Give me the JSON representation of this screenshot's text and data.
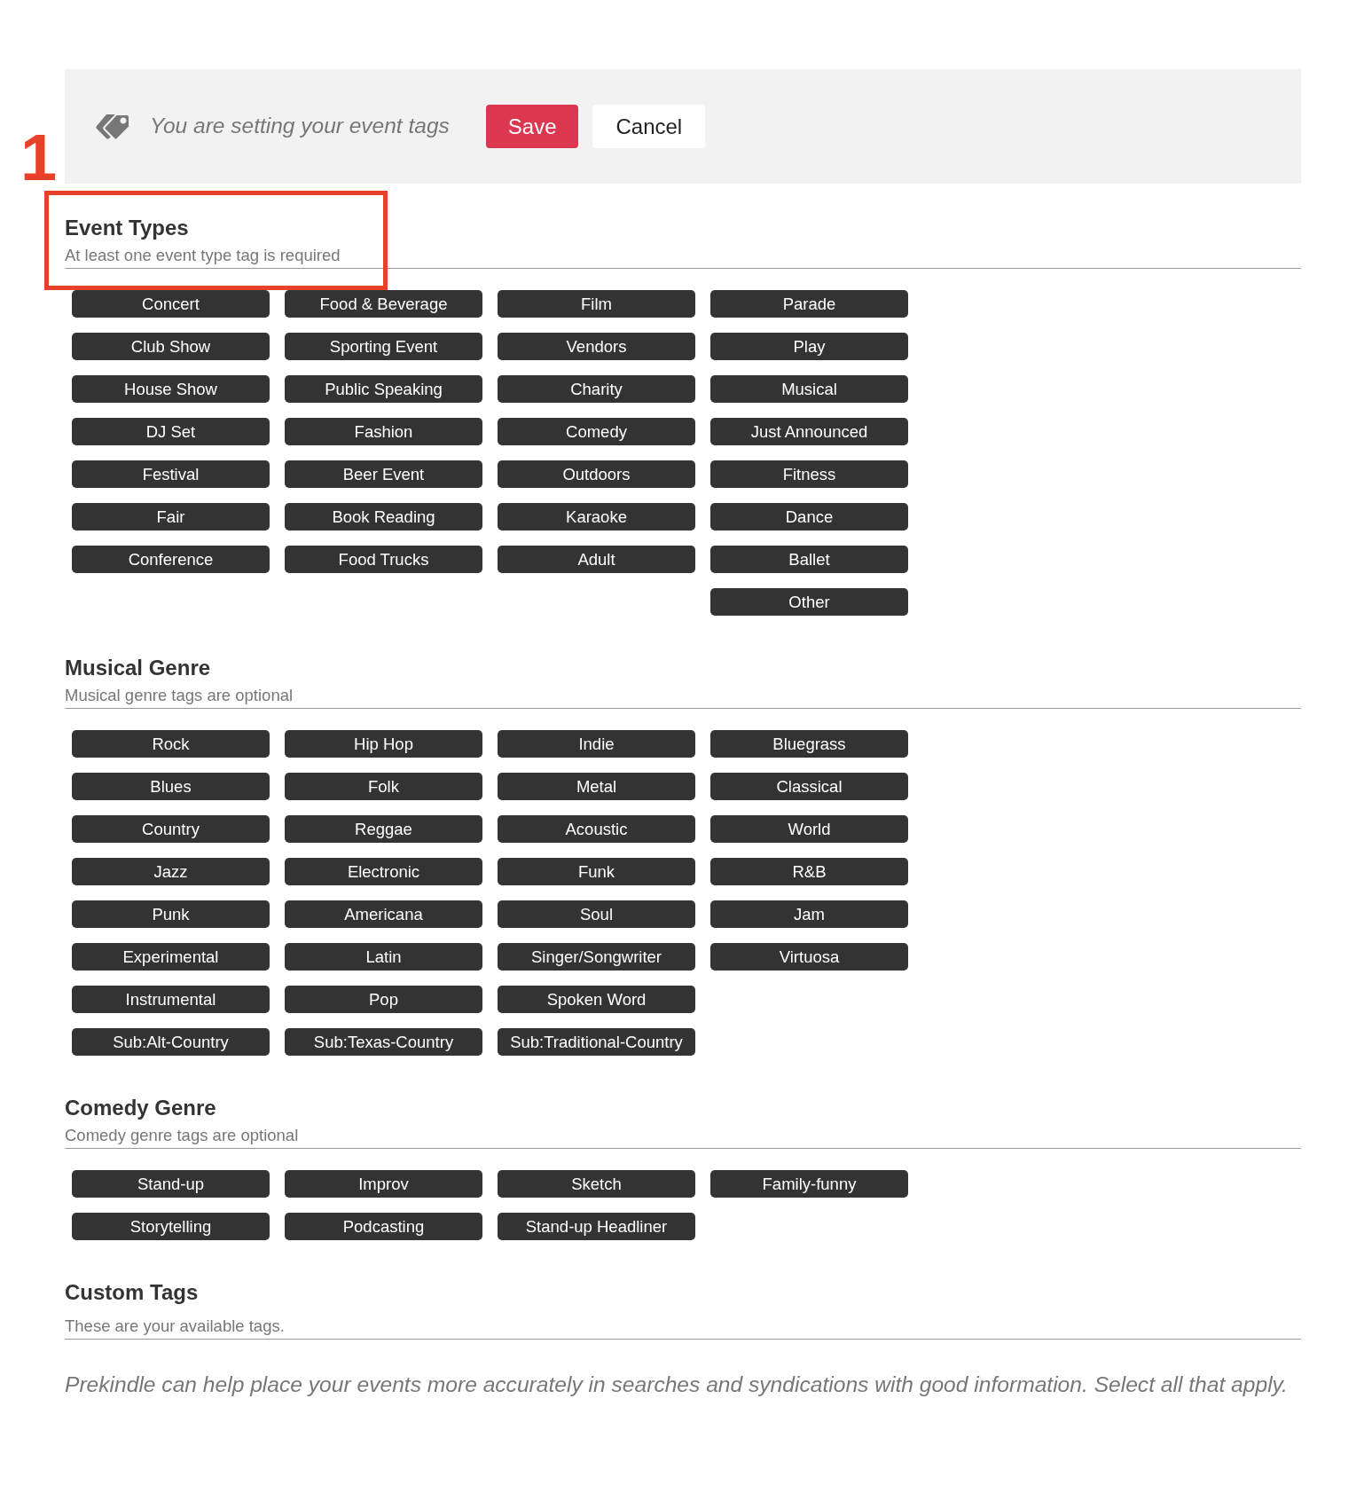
{
  "toolbar": {
    "message": "You are setting your event tags",
    "buttons": [
      {
        "label": "Save",
        "kind": "primary"
      },
      {
        "label": "Cancel",
        "kind": "secondary"
      }
    ]
  },
  "sections": [
    {
      "kind": "preset",
      "title": "Event Types",
      "subtitle": "At least one event type tag is required",
      "callout": "1",
      "columns": [
        [
          {
            "label": "Concert",
            "selected": false
          },
          {
            "label": "Club Show",
            "selected": false
          },
          {
            "label": "House Show",
            "selected": false
          },
          {
            "label": "DJ Set",
            "selected": false
          },
          {
            "label": "Festival",
            "selected": false
          },
          {
            "label": "Fair",
            "selected": false
          },
          {
            "label": "Conference",
            "selected": false
          }
        ],
        [
          {
            "label": "Food & Beverage",
            "selected": false
          },
          {
            "label": "Sporting Event",
            "selected": false
          },
          {
            "label": "Public Speaking",
            "selected": false
          },
          {
            "label": "Fashion",
            "selected": false
          },
          {
            "label": "Beer Event",
            "selected": false
          },
          {
            "label": "Book Reading",
            "selected": false
          },
          {
            "label": "Food Trucks",
            "selected": false
          }
        ],
        [
          {
            "label": "Film",
            "selected": false
          },
          {
            "label": "Vendors",
            "selected": false
          },
          {
            "label": "Charity",
            "selected": false
          },
          {
            "label": "Comedy",
            "selected": false
          },
          {
            "label": "Outdoors",
            "selected": false
          },
          {
            "label": "Karaoke",
            "selected": false
          },
          {
            "label": "Adult",
            "selected": false
          }
        ],
        [
          {
            "label": "Parade",
            "selected": false
          },
          {
            "label": "Play",
            "selected": false
          },
          {
            "label": "Musical",
            "selected": false
          },
          {
            "label": "Just Announced",
            "selected": false
          },
          {
            "label": "Fitness",
            "selected": false
          },
          {
            "label": "Dance",
            "selected": false
          },
          {
            "label": "Ballet",
            "selected": false
          },
          {
            "label": "Other",
            "selected": false
          }
        ]
      ]
    },
    {
      "kind": "preset",
      "title": "Musical Genre",
      "subtitle": "Musical genre tags are optional",
      "columns": [
        [
          {
            "label": "Rock",
            "selected": false
          },
          {
            "label": "Blues",
            "selected": false
          },
          {
            "label": "Country",
            "selected": false
          },
          {
            "label": "Jazz",
            "selected": false
          },
          {
            "label": "Punk",
            "selected": false
          },
          {
            "label": "Experimental",
            "selected": false
          },
          {
            "label": "Instrumental",
            "selected": false
          },
          {
            "label": "Sub:Alt-Country",
            "selected": false
          }
        ],
        [
          {
            "label": "Hip Hop",
            "selected": false
          },
          {
            "label": "Folk",
            "selected": false
          },
          {
            "label": "Reggae",
            "selected": false
          },
          {
            "label": "Electronic",
            "selected": false
          },
          {
            "label": "Americana",
            "selected": false
          },
          {
            "label": "Latin",
            "selected": false
          },
          {
            "label": "Pop",
            "selected": false
          },
          {
            "label": "Sub:Texas-Country",
            "selected": false
          }
        ],
        [
          {
            "label": "Indie",
            "selected": false
          },
          {
            "label": "Metal",
            "selected": false
          },
          {
            "label": "Acoustic",
            "selected": false
          },
          {
            "label": "Funk",
            "selected": false
          },
          {
            "label": "Soul",
            "selected": false
          },
          {
            "label": "Singer/Songwriter",
            "selected": false
          },
          {
            "label": "Spoken Word",
            "selected": false
          },
          {
            "label": "Sub:Traditional-Country",
            "selected": false
          }
        ],
        [
          {
            "label": "Bluegrass",
            "selected": false
          },
          {
            "label": "Classical",
            "selected": false
          },
          {
            "label": "World",
            "selected": false
          },
          {
            "label": "R&B",
            "selected": false
          },
          {
            "label": "Jam",
            "selected": false
          },
          {
            "label": "Virtuosa",
            "selected": false
          }
        ]
      ]
    },
    {
      "kind": "preset",
      "title": "Comedy Genre",
      "subtitle": "Comedy genre tags are optional",
      "columns": [
        [
          {
            "label": "Stand-up",
            "selected": false
          },
          {
            "label": "Storytelling",
            "selected": false
          }
        ],
        [
          {
            "label": "Improv",
            "selected": false
          },
          {
            "label": "Podcasting",
            "selected": false
          }
        ],
        [
          {
            "label": "Sketch",
            "selected": false
          },
          {
            "label": "Stand-up Headliner",
            "selected": false
          }
        ],
        [
          {
            "label": "Family-funny",
            "selected": false
          }
        ]
      ]
    },
    {
      "kind": "custom",
      "title": "Custom Tags",
      "subtitle": "These are your available tags."
    }
  ],
  "footer_note": "Prekindle can help place your events more accurately in searches and syndications with good information. Select all that apply."
}
